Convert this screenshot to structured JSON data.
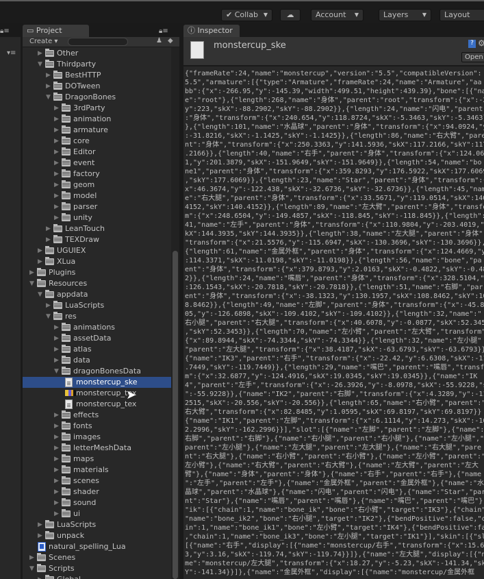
{
  "toolbar": {
    "collab": "Collab",
    "account": "Account",
    "layers": "Layers",
    "layout": "Layout"
  },
  "project": {
    "tab": "Project",
    "create": "Create",
    "search_placeholder": ""
  },
  "inspector": {
    "tab": "Inspector",
    "title": "monstercup_ske",
    "open": "Open"
  },
  "colors": {
    "selection": "#2d4d89",
    "panel": "#282828"
  },
  "tree": [
    {
      "label": "Other",
      "depth": 1,
      "type": "folder",
      "arrow": "right"
    },
    {
      "label": "Thirdparty",
      "depth": 1,
      "type": "folder",
      "arrow": "down"
    },
    {
      "label": "BestHTTP",
      "depth": 2,
      "type": "folder",
      "arrow": "right"
    },
    {
      "label": "DOTween",
      "depth": 2,
      "type": "folder",
      "arrow": "right"
    },
    {
      "label": "DragonBones",
      "depth": 2,
      "type": "folder",
      "arrow": "down"
    },
    {
      "label": "3rdParty",
      "depth": 3,
      "type": "folder",
      "arrow": "right"
    },
    {
      "label": "animation",
      "depth": 3,
      "type": "folder",
      "arrow": "right"
    },
    {
      "label": "armature",
      "depth": 3,
      "type": "folder",
      "arrow": "right"
    },
    {
      "label": "core",
      "depth": 3,
      "type": "folder",
      "arrow": "right"
    },
    {
      "label": "Editor",
      "depth": 3,
      "type": "folder",
      "arrow": "right"
    },
    {
      "label": "event",
      "depth": 3,
      "type": "folder",
      "arrow": "right"
    },
    {
      "label": "factory",
      "depth": 3,
      "type": "folder",
      "arrow": "right"
    },
    {
      "label": "geom",
      "depth": 3,
      "type": "folder",
      "arrow": "right"
    },
    {
      "label": "model",
      "depth": 3,
      "type": "folder",
      "arrow": "right"
    },
    {
      "label": "parser",
      "depth": 3,
      "type": "folder",
      "arrow": "right"
    },
    {
      "label": "unity",
      "depth": 3,
      "type": "folder",
      "arrow": "right"
    },
    {
      "label": "LeanTouch",
      "depth": 2,
      "type": "folder",
      "arrow": "right"
    },
    {
      "label": "TEXDraw",
      "depth": 2,
      "type": "folder",
      "arrow": "right"
    },
    {
      "label": "UGUIEX",
      "depth": 1,
      "type": "folder",
      "arrow": "right"
    },
    {
      "label": "XLua",
      "depth": 1,
      "type": "folder",
      "arrow": "right"
    },
    {
      "label": "Plugins",
      "depth": 0,
      "type": "folder",
      "arrow": "right"
    },
    {
      "label": "Resources",
      "depth": 0,
      "type": "folder",
      "arrow": "down"
    },
    {
      "label": "appdata",
      "depth": 1,
      "type": "folder",
      "arrow": "down"
    },
    {
      "label": "LuaScripts",
      "depth": 2,
      "type": "folder",
      "arrow": "right"
    },
    {
      "label": "res",
      "depth": 2,
      "type": "folder",
      "arrow": "down"
    },
    {
      "label": "animations",
      "depth": 3,
      "type": "folder",
      "arrow": "right"
    },
    {
      "label": "assetData",
      "depth": 3,
      "type": "folder",
      "arrow": "right"
    },
    {
      "label": "atlas",
      "depth": 3,
      "type": "folder",
      "arrow": "right"
    },
    {
      "label": "data",
      "depth": 3,
      "type": "folder",
      "arrow": "right"
    },
    {
      "label": "dragonBonesData",
      "depth": 3,
      "type": "folder",
      "arrow": "down"
    },
    {
      "label": "monstercup_ske",
      "depth": 4,
      "type": "text",
      "selected": true
    },
    {
      "label": "monstercup_tex",
      "depth": 4,
      "type": "image"
    },
    {
      "label": "monstercup_tex",
      "depth": 4,
      "type": "text"
    },
    {
      "label": "effects",
      "depth": 3,
      "type": "folder",
      "arrow": "right"
    },
    {
      "label": "fonts",
      "depth": 3,
      "type": "folder",
      "arrow": "right"
    },
    {
      "label": "images",
      "depth": 3,
      "type": "folder",
      "arrow": "right"
    },
    {
      "label": "letterMeshData",
      "depth": 3,
      "type": "folder",
      "arrow": "right"
    },
    {
      "label": "maps",
      "depth": 3,
      "type": "folder",
      "arrow": "right"
    },
    {
      "label": "materials",
      "depth": 3,
      "type": "folder",
      "arrow": "right"
    },
    {
      "label": "scenes",
      "depth": 3,
      "type": "folder",
      "arrow": "right"
    },
    {
      "label": "shader",
      "depth": 3,
      "type": "folder",
      "arrow": "right"
    },
    {
      "label": "sound",
      "depth": 3,
      "type": "folder",
      "arrow": "right"
    },
    {
      "label": "ui",
      "depth": 3,
      "type": "folder",
      "arrow": "right"
    },
    {
      "label": "LuaScripts",
      "depth": 1,
      "type": "folder",
      "arrow": "right"
    },
    {
      "label": "unpack",
      "depth": 1,
      "type": "folder",
      "arrow": "right"
    },
    {
      "label": "natural_spelling_Lua",
      "depth": 1,
      "type": "lua"
    },
    {
      "label": "Scenes",
      "depth": 0,
      "type": "folder",
      "arrow": "right"
    },
    {
      "label": "Scripts",
      "depth": 0,
      "type": "folder",
      "arrow": "down"
    },
    {
      "label": "Global",
      "depth": 1,
      "type": "folder",
      "arrow": "right"
    }
  ],
  "code_lines": [
    "{\"frameRate\":24,\"name\":\"monstercup\",\"version\":\"5.5\",\"compatibleVersion\":",
    "5.5\",\"armature\":[{\"type\":\"Armature\",\"frameRate\":24,\"name\":\"Armature\",\"aa",
    "bb\":{\"x\":-266.95,\"y\":-145.39,\"width\":499.51,\"height\":439.39},\"bone\":[{\"nam",
    "e\":\"root\"},{\"length\":268,\"name\":\"身体\",\"parent\":\"root\",\"transform\":{\"x\":-20,",
    "y\":223,\"skX\":-88.2902,\"skY\":-88.2902}},{\"length\":24,\"name\":\"闪电\",\"parent",
    ":\"身体\",\"transform\":{\"x\":240.654,\"y\":118.8724,\"skX\":-5.3463,\"skY\":-5.3463}",
    "},{\"length\":101,\"name\":\"水晶球\",\"parent\":\"身体\",\"transform\":{\"x\":94.0924,\"y",
    ":-31.8216,\"skX\":-1.1425,\"skY\":-1.1425}},{\"length\":86,\"name\":\"右大臂\",\"pare",
    "nt\":\"身体\",\"transform\":{\"x\":250.3363,\"y\":141.5936,\"skX\":117.2166,\"skY\":117",
    ".2166}},{\"length\":40,\"name\":\"右手\",\"parent\":\"身体\",\"transform\":{\"x\":124.064",
    "1,\"y\":201.3879,\"skX\":-151.9649,\"skY\":-151.9649}},{\"length\":54,\"name\":\"bo",
    "ne1\",\"parent\":\"身体\",\"transform\":{\"x\":359.8293,\"y\":176.5922,\"skX\":177.6069",
    ",\"skY\":177.6069}},{\"length\":23,\"name\":\"Star\",\"parent\":\"身体\",\"transform\":{\"",
    "x\":46.3674,\"y\":-122.438,\"skX\":-32.6736,\"skY\":-32.6736}},{\"length\":45,\"nam",
    "e\":\"右大腿\",\"parent\":\"身体\",\"transform\":{\"x\":33.5671,\"y\":119.0514,\"skX\":140.",
    "4152,\"skY\":140.4152}},{\"length\":89,\"name\":\"左大臂\",\"parent\":\"身体\",\"transfo",
    "m\":{\"x\":248.6504,\"y\":-149.4857,\"skX\":-118.845,\"skY\":-118.845}},{\"length\":",
    "41,\"name\":\"左手\",\"parent\":\"身体\",\"transform\":{\"x\":110.9804,\"y\":-203.4019,\"s",
    "kX\":144.3935,\"skY\":144.3935}},{\"length\":38,\"name\":\"左大腿\",\"parent\":\"身体\",",
    "\"transform\":{\"x\":21.5576,\"y\":-115.6947,\"skX\":-130.3696,\"skY\":-130.3696}},",
    "{\"length\":61,\"name\":\"金属外框\",\"parent\":\"身体\",\"transform\":{\"x\":124.4669,\"y",
    ":114.3371,\"skX\":-11.0198,\"skY\":-11.0198}},{\"length\":56,\"name\":\"bone\",\"pa",
    "ent\":\"身体\",\"transform\":{\"x\":379.8793,\"y\":2.0163,\"skX\":-0.4822,\"skY\":-0.482",
    "2}},{\"length\":24,\"name\":\"嘴唇\",\"parent\":\"身体\",\"transform\":{\"x\":328.5104,\"y",
    ":126.1543,\"skX\":-20.7818,\"skY\":-20.7818}},{\"length\":51,\"name\":\"右脚\",\"par",
    "ent\":\"身体\",\"transform\":{\"x\":-38.1323,\"y\":130.1957,\"skX\":108.8462,\"skY\":10",
    "8.8462}},{\"length\":49,\"name\":\"左脚\",\"parent\":\"身体\",\"transform\":{\"x\":-45.80",
    "05,\"y\":-126.6898,\"skX\":-109.4102,\"skY\":-109.4102}},{\"length\":32,\"name\":\"",
    "右小腿\",\"parent\":\"右大腿\",\"transform\":{\"x\":40.6078,\"y\":-0.0877,\"skX\":52.345",
    ",\"skY\":52.3453}},{\"length\":70,\"name\":\"左小臂\",\"parent\":\"左大臂\",\"transform\"",
    "{\"x\":89.8944,\"skX\":-74.3344,\"skY\":-74.3344}},{\"length\":32,\"name\":\"左小腿\"",
    "\"parent\":\"左大腿\",\"transform\":{\"x\":38.4187,\"skX\":-63.6793,\"skY\":-63.6793}}",
    "{\"name\":\"IK3\",\"parent\":\"右手\",\"transform\":{\"x\":-22.42,\"y\":6.6308,\"skX\":-11",
    ".7449,\"skY\":-119.7449}},{\"length\":29,\"name\":\"嘴巴\",\"parent\":\"嘴唇\",\"transfo",
    "m\":{\"x\":32.6877,\"y\":-124.4916,\"skX\":19.0345,\"skY\":19.0345}},{\"name\":\"IK",
    "4\",\"parent\":\"左手\",\"transform\":{\"x\":-26.3926,\"y\":-8.0978,\"skX\":-55.9228,\"sk",
    "\":-55.9228}},{\"name\":\"IK2\",\"parent\":\"右脚\",\"transform\":{\"x\":4.3289,\"y\":-11",
    "2515,\"skX\":-20.556,\"skY\":-20.556}},{\"length\":65,\"name\":\"右小臂\",\"parent\":\"",
    "右大臂\",\"transform\":{\"x\":82.8485,\"y\":1.0595,\"skX\":69.8197,\"skY\":69.8197}}",
    "{\"name\":\"IK1\",\"parent\":\"左脚\",\"transform\":{\"x\":6.1114,\"y\":14.273,\"skX\":-16",
    "2.2996,\"skY\":-162.2996}}],\"slot\":[{\"name\":\"左脚\",\"parent\":\"左脚\"},{\"name\":",
    "右脚\",\"parent\":\"右脚\"},{\"name\":\"右小腿\",\"parent\":\"右小腿\"},{\"name\":\"左小腿\",\"",
    "parent\":\"左小腿\"},{\"name\":\"左大腿\",\"parent\":\"左大腿\"},{\"name\":\"右大腿\",\"pare",
    "nt\":\"右大腿\"},{\"name\":\"右小臂\",\"parent\":\"右小臂\"},{\"name\":\"左小臂\",\"parent\":\"",
    "左小臂\"},{\"name\":\"右大臂\",\"parent\":\"右大臂\"},{\"name\":\"左大臂\",\"parent\":\"左大",
    "臂\"},{\"name\":\"身体\",\"parent\":\"身体\"},{\"name\":\"右手\",\"parent\":\"右手\"},{\"name",
    "\":\"左手\",\"parent\":\"左手\"},{\"name\":\"金属外框\",\"parent\":\"金属外框\"},{\"name\":\"水",
    "晶球\",\"parent\":\"水晶球\"},{\"name\":\"闪电\",\"parent\":\"闪电\"},{\"name\":\"Star\",\"par",
    "nt\":\"Star\"},{\"name\":\"嘴唇\",\"parent\":\"嘴唇\"},{\"name\":\"嘴巴\",\"parent\":\"嘴巴\"}]",
    "\"ik\":[{\"chain\":1,\"name\":\"bone_ik\",\"bone\":\"右小臂\",\"target\":\"IK3\"},{\"chain\":1",
    "\"name\":\"bone_ik2\",\"bone\":\"右小腿\",\"target\":\"IK2\"},{\"bendPositive\":false,\"ch",
    "in\":1,\"name\":\"bone_ik1\",\"bone\":\"左小臂\",\"target\":\"IK4\"},{\"bendPositive\":fals",
    ",\"chain\":1,\"name\":\"bone_ik3\",\"bone\":\"左小腿\",\"target\":\"IK1\"}],\"skin\":[{\"slot",
    "[{\"name\":\"右手\",\"display\":[{\"name\":\"monstercup/右手\",\"transform\":{\"x\":15.6",
    "3,\"y\":3.16,\"skX\":-119.74,\"skY\":-119.74}}]},{\"name\":\"左大腿\",\"display\":[{\"na",
    "me\":\"monstercup/左大腿\",\"transform\":{\"x\":18.27,\"y\":-5.23,\"skX\":-141.34,\"sk",
    "Y\":-141.34}}]},{\"name\":\"金属外框\",\"display\":[{\"name\":\"monstercup/金属外框"
  ]
}
